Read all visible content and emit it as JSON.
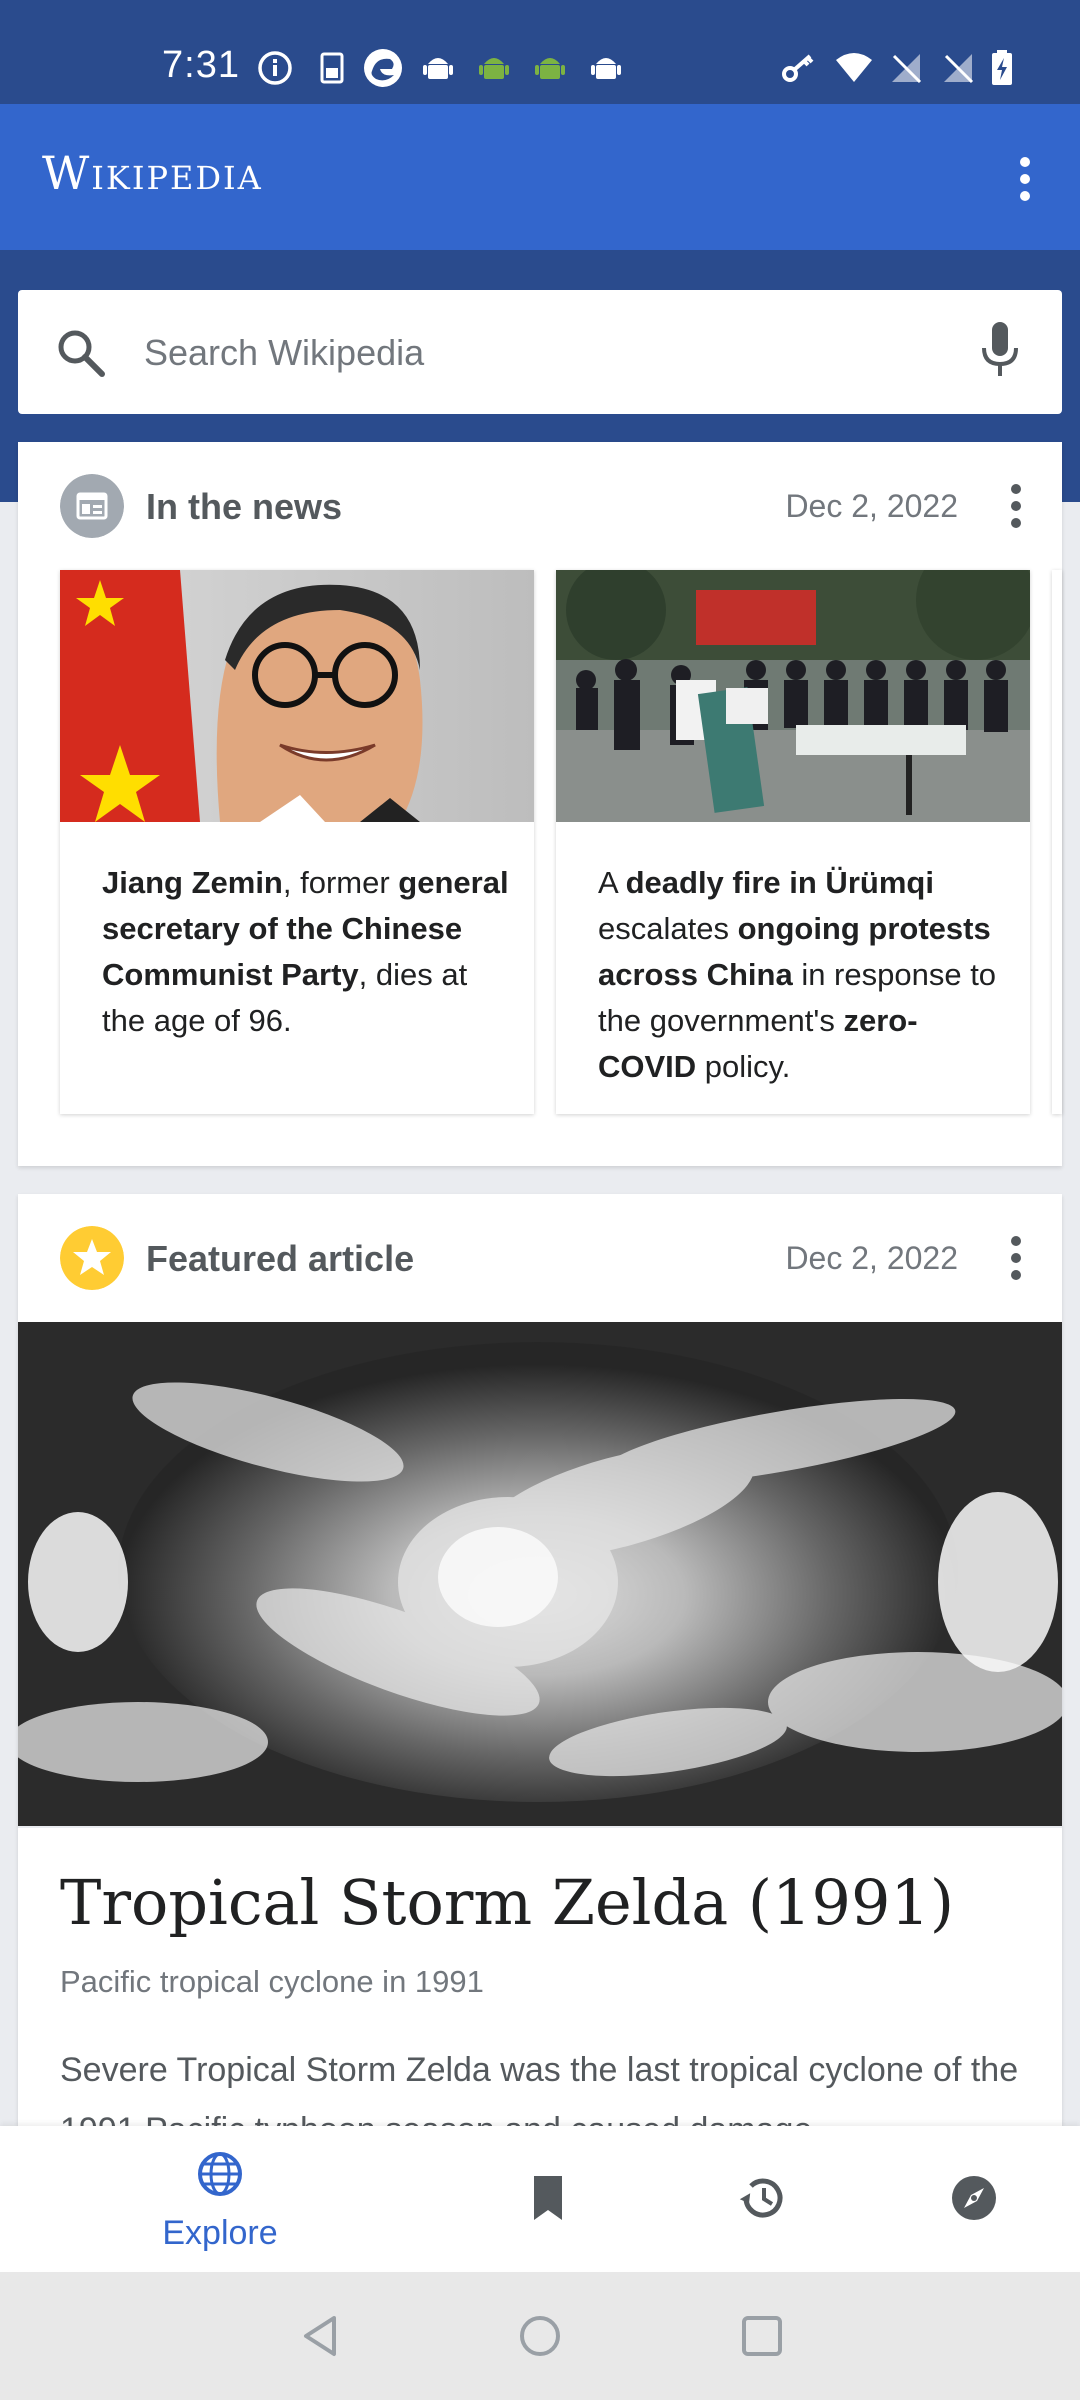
{
  "status_bar": {
    "time": "7:31",
    "left_icons": [
      "info-icon",
      "sim-card-icon",
      "edge-browser-icon",
      "android-white-icon",
      "android-green-icon",
      "android-green-icon",
      "android-white-icon"
    ],
    "right_icons": [
      "vpn-key-icon",
      "wifi-icon",
      "signal-off-icon",
      "signal-off-icon",
      "battery-charging-icon"
    ]
  },
  "app_bar": {
    "wordmark": "Wikipedia",
    "menu_icon": "overflow-menu-icon"
  },
  "search": {
    "placeholder": "Search Wikipedia",
    "mic_icon": "microphone-icon"
  },
  "in_the_news": {
    "title": "In the news",
    "date": "Dec 2, 2022",
    "items": [
      {
        "image": "portrait-photo",
        "parts": [
          {
            "t": "Jiang Zemin",
            "b": true
          },
          {
            "t": ", former ",
            "b": false
          },
          {
            "t": "general secretary of the Chinese Communist Party",
            "b": true
          },
          {
            "t": ", dies at the age of 96.",
            "b": false
          }
        ]
      },
      {
        "image": "protest-photo",
        "parts": [
          {
            "t": "A ",
            "b": false
          },
          {
            "t": "deadly fire in Ürümqi",
            "b": true
          },
          {
            "t": " escalates ",
            "b": false
          },
          {
            "t": "ongoing protests across China",
            "b": true
          },
          {
            "t": " in response to the government's ",
            "b": false
          },
          {
            "t": "zero-COVID",
            "b": true
          },
          {
            "t": " policy.",
            "b": false
          }
        ]
      }
    ]
  },
  "featured_article": {
    "title": "Featured article",
    "date": "Dec 2, 2022",
    "image": "satellite-storm-photo",
    "article_title": "Tropical Storm Zelda (1991)",
    "description": "Pacific tropical cyclone in 1991",
    "extract": "Severe Tropical Storm Zelda was the last tropical cyclone of the 1991 Pacific typhoon season and caused damage"
  },
  "bottom_nav": {
    "explore_label": "Explore",
    "items": [
      "explore-icon",
      "saved-bookmark-icon",
      "history-icon",
      "places-compass-icon"
    ],
    "active_color": "#3366cc"
  },
  "system_nav": [
    "back-icon",
    "home-icon",
    "recents-icon"
  ]
}
